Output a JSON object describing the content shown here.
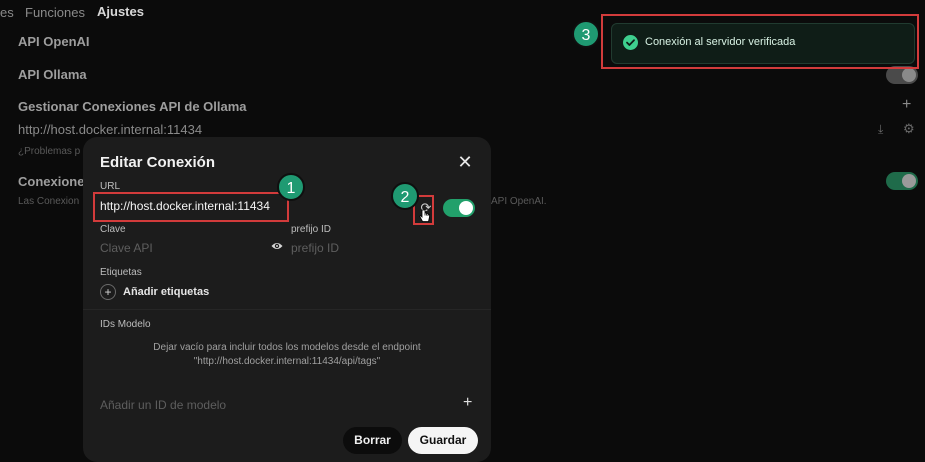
{
  "background": {
    "tabs": [
      "es",
      "Funciones",
      "Ajustes"
    ],
    "row_openai": "API OpenAI",
    "row_ollama": "API Ollama",
    "manage_label": "Gestionar Conexiones API de Ollama",
    "host_url": "http://host.docker.internal:11434",
    "problems_text": "¿Problemas p",
    "connections_label": "Conexiones",
    "connections_desc_left": "Las Conexion",
    "connections_desc_right": "API OpenAI."
  },
  "modal": {
    "title": "Editar Conexión",
    "url_label": "URL",
    "url_value": "http://host.docker.internal:11434",
    "key_label": "Clave",
    "key_placeholder": "Clave API",
    "prefix_label": "prefijo ID",
    "prefix_placeholder": "prefijo ID",
    "tags_label": "Etiquetas",
    "add_tags": "Añadir etiquetas",
    "model_ids_label": "IDs Modelo",
    "model_ids_help_1": "Dejar vacío para incluir todos los modelos desde el endpoint",
    "model_ids_help_2": "\"http://host.docker.internal:11434/api/tags\"",
    "add_model_placeholder": "Añadir un ID de modelo",
    "delete_button": "Borrar",
    "save_button": "Guardar"
  },
  "toast": {
    "message": "Conexión al servidor verificada"
  },
  "annotations": [
    "1",
    "2",
    "3"
  ],
  "colors": {
    "accent": "#1f9a72",
    "annotation_red": "#d23b3b",
    "toggle_on": "#22a06b"
  }
}
